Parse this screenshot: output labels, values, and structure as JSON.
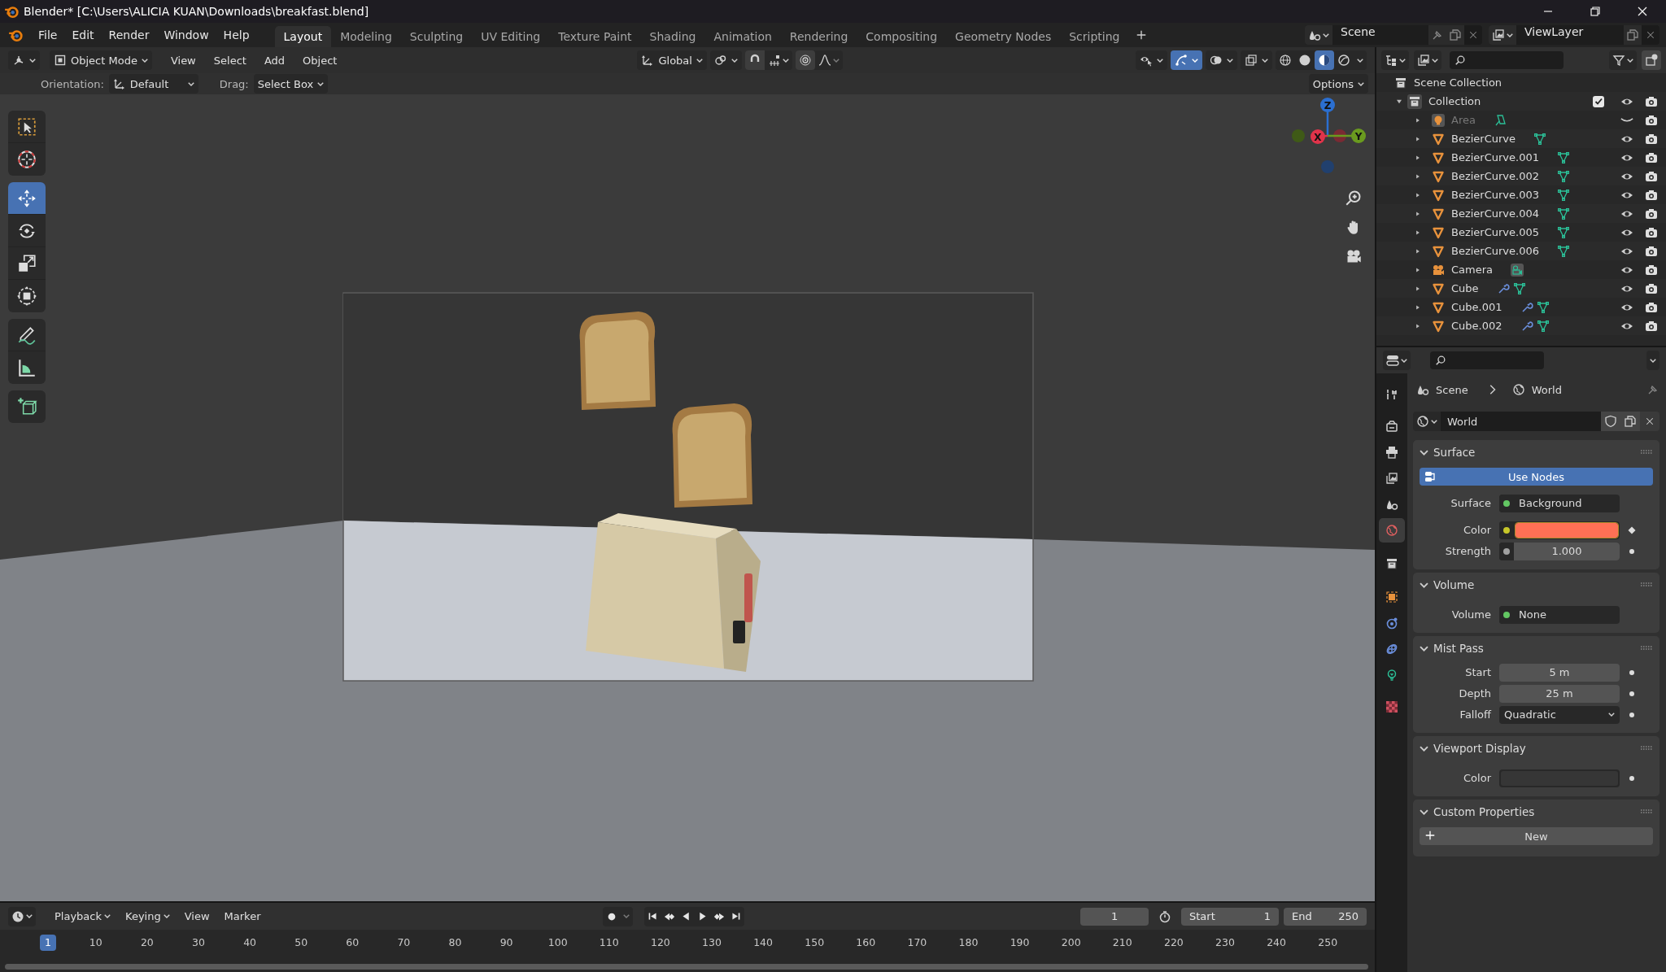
{
  "window": {
    "title": "Blender* [C:\\Users\\ALICIA KUAN\\Downloads\\breakfast.blend]"
  },
  "menu": [
    "File",
    "Edit",
    "Render",
    "Window",
    "Help"
  ],
  "workspaces": [
    {
      "label": "Layout",
      "selected": true
    },
    {
      "label": "Modeling",
      "selected": false
    },
    {
      "label": "Sculpting",
      "selected": false
    },
    {
      "label": "UV Editing",
      "selected": false
    },
    {
      "label": "Texture Paint",
      "selected": false
    },
    {
      "label": "Shading",
      "selected": false
    },
    {
      "label": "Animation",
      "selected": false
    },
    {
      "label": "Rendering",
      "selected": false
    },
    {
      "label": "Compositing",
      "selected": false
    },
    {
      "label": "Geometry Nodes",
      "selected": false
    },
    {
      "label": "Scripting",
      "selected": false
    }
  ],
  "scene": "Scene",
  "view_layer": "ViewLayer",
  "viewport": {
    "mode": "Object Mode",
    "menus": [
      "View",
      "Select",
      "Add",
      "Object"
    ],
    "orientation": "Global",
    "toggles": [
      {
        "kind": "selectability",
        "on": false
      },
      {
        "kind": "gizmos",
        "on": true
      },
      {
        "kind": "overlays",
        "on": false
      },
      {
        "kind": "xray",
        "on": false
      }
    ],
    "shading": [
      {
        "kind": "wireframe",
        "selected": false
      },
      {
        "kind": "solid",
        "selected": false
      },
      {
        "kind": "material",
        "selected": true
      },
      {
        "kind": "rendered",
        "selected": false
      }
    ],
    "tool_settings": {
      "orientation_label": "Orientation:",
      "orientation": "Default",
      "drag_label": "Drag:",
      "drag": "Select Box",
      "options": "Options"
    },
    "toolbar": [
      {
        "tools": [
          {
            "kind": "select_box",
            "selected": false
          },
          {
            "kind": "cursor",
            "selected": false
          }
        ]
      },
      {
        "tools": [
          {
            "kind": "move",
            "selected": true
          },
          {
            "kind": "rotate",
            "selected": false
          },
          {
            "kind": "scale",
            "selected": false
          },
          {
            "kind": "transform",
            "selected": false
          }
        ]
      },
      {
        "tools": [
          {
            "kind": "annotate",
            "selected": false
          },
          {
            "kind": "measure",
            "selected": false
          }
        ]
      },
      {
        "tools": [
          {
            "kind": "add_cube",
            "selected": false
          }
        ]
      }
    ],
    "gizmo": {
      "axes": [
        {
          "kind": "z",
          "label": "Z"
        },
        {
          "kind": "y",
          "label": "Y"
        },
        {
          "kind": "x",
          "label": "X"
        }
      ]
    }
  },
  "outliner": {
    "root": "Scene Collection",
    "collections": [
      {
        "name": "Collection",
        "expanded": true,
        "checked": true,
        "visible": true,
        "children": [
          {
            "name": "Area",
            "kind": "light",
            "modifiers": false,
            "visible": false
          },
          {
            "name": "BezierCurve",
            "kind": "curve",
            "modifiers": false,
            "visible": true
          },
          {
            "name": "BezierCurve.001",
            "kind": "curve",
            "modifiers": false,
            "visible": true
          },
          {
            "name": "BezierCurve.002",
            "kind": "curve",
            "modifiers": false,
            "visible": true
          },
          {
            "name": "BezierCurve.003",
            "kind": "curve",
            "modifiers": false,
            "visible": true
          },
          {
            "name": "BezierCurve.004",
            "kind": "curve",
            "modifiers": false,
            "visible": true
          },
          {
            "name": "BezierCurve.005",
            "kind": "curve",
            "modifiers": false,
            "visible": true
          },
          {
            "name": "BezierCurve.006",
            "kind": "curve",
            "modifiers": false,
            "visible": true
          },
          {
            "name": "Camera",
            "kind": "camera",
            "modifiers": false,
            "visible": true
          },
          {
            "name": "Cube",
            "kind": "mesh",
            "modifiers": true,
            "visible": true
          },
          {
            "name": "Cube.001",
            "kind": "mesh",
            "modifiers": true,
            "visible": true
          },
          {
            "name": "Cube.002",
            "kind": "mesh",
            "modifiers": true,
            "visible": true
          }
        ]
      }
    ]
  },
  "properties": {
    "tabs": [
      {
        "kind": "tool",
        "selected": false
      },
      {
        "kind": "render",
        "selected": false
      },
      {
        "kind": "output",
        "selected": false
      },
      {
        "kind": "view_layer",
        "selected": false
      },
      {
        "kind": "scene",
        "selected": false
      },
      {
        "kind": "world",
        "selected": true
      },
      {
        "kind": "collection",
        "selected": false
      },
      {
        "kind": "object",
        "selected": false
      },
      {
        "kind": "physics",
        "selected": false
      },
      {
        "kind": "constraints",
        "selected": false
      },
      {
        "kind": "data",
        "selected": false
      },
      {
        "kind": "texture",
        "selected": false
      }
    ],
    "breadcrumb": [
      "Scene",
      "World"
    ],
    "world": "World",
    "panels": [
      {
        "title": "Surface",
        "expanded": true,
        "rows": [
          {
            "kind": "button",
            "label": "Use Nodes"
          },
          {
            "kind": "link",
            "label": "Surface",
            "value": "Background",
            "socket": {
              "color": "#63c763"
            }
          },
          {
            "kind": "color",
            "label": "Color",
            "socket": {
              "color": "#c7c729"
            },
            "swatch": {
              "color": "#ff7055"
            },
            "decorator": {
              "kind": "keyframe"
            }
          },
          {
            "kind": "number",
            "label": "Strength",
            "value": "1.000",
            "socket": {
              "color": "#a1a1a1"
            },
            "decorator": {
              "kind": "dot"
            }
          }
        ]
      },
      {
        "title": "Volume",
        "expanded": true,
        "rows": [
          {
            "kind": "link",
            "label": "Volume",
            "value": "None",
            "socket": {
              "color": "#63c763"
            }
          }
        ]
      },
      {
        "title": "Mist Pass",
        "expanded": true,
        "rows": [
          {
            "kind": "number",
            "label": "Start",
            "value": "5 m",
            "decorator": {
              "kind": "dot"
            }
          },
          {
            "kind": "number",
            "label": "Depth",
            "value": "25 m",
            "decorator": {
              "kind": "dot"
            }
          },
          {
            "kind": "dropdown",
            "label": "Falloff",
            "value": "Quadratic",
            "decorator": {
              "kind": "dot"
            }
          }
        ]
      },
      {
        "title": "Viewport Display",
        "expanded": true,
        "rows": [
          {
            "kind": "color",
            "label": "Color",
            "swatch": {
              "color": "#363636"
            },
            "decorator": {
              "kind": "dot"
            }
          }
        ]
      },
      {
        "title": "Custom Properties",
        "expanded": true,
        "rows": [
          {
            "kind": "add_button",
            "label": "New"
          }
        ]
      }
    ]
  },
  "timeline": {
    "menus": [
      {
        "label": "Playback",
        "dropdown": true
      },
      {
        "label": "Keying",
        "dropdown": true
      },
      {
        "label": "View",
        "dropdown": false
      },
      {
        "label": "Marker",
        "dropdown": false
      }
    ],
    "frame": "1",
    "start_label": "Start",
    "start": "1",
    "end_label": "End",
    "end": "250",
    "playhead": "1",
    "ticks": [
      "10",
      "20",
      "30",
      "40",
      "50",
      "60",
      "70",
      "80",
      "90",
      "100",
      "110",
      "120",
      "130",
      "140",
      "150",
      "160",
      "170",
      "180",
      "190",
      "200",
      "210",
      "220",
      "230",
      "240",
      "250"
    ]
  }
}
